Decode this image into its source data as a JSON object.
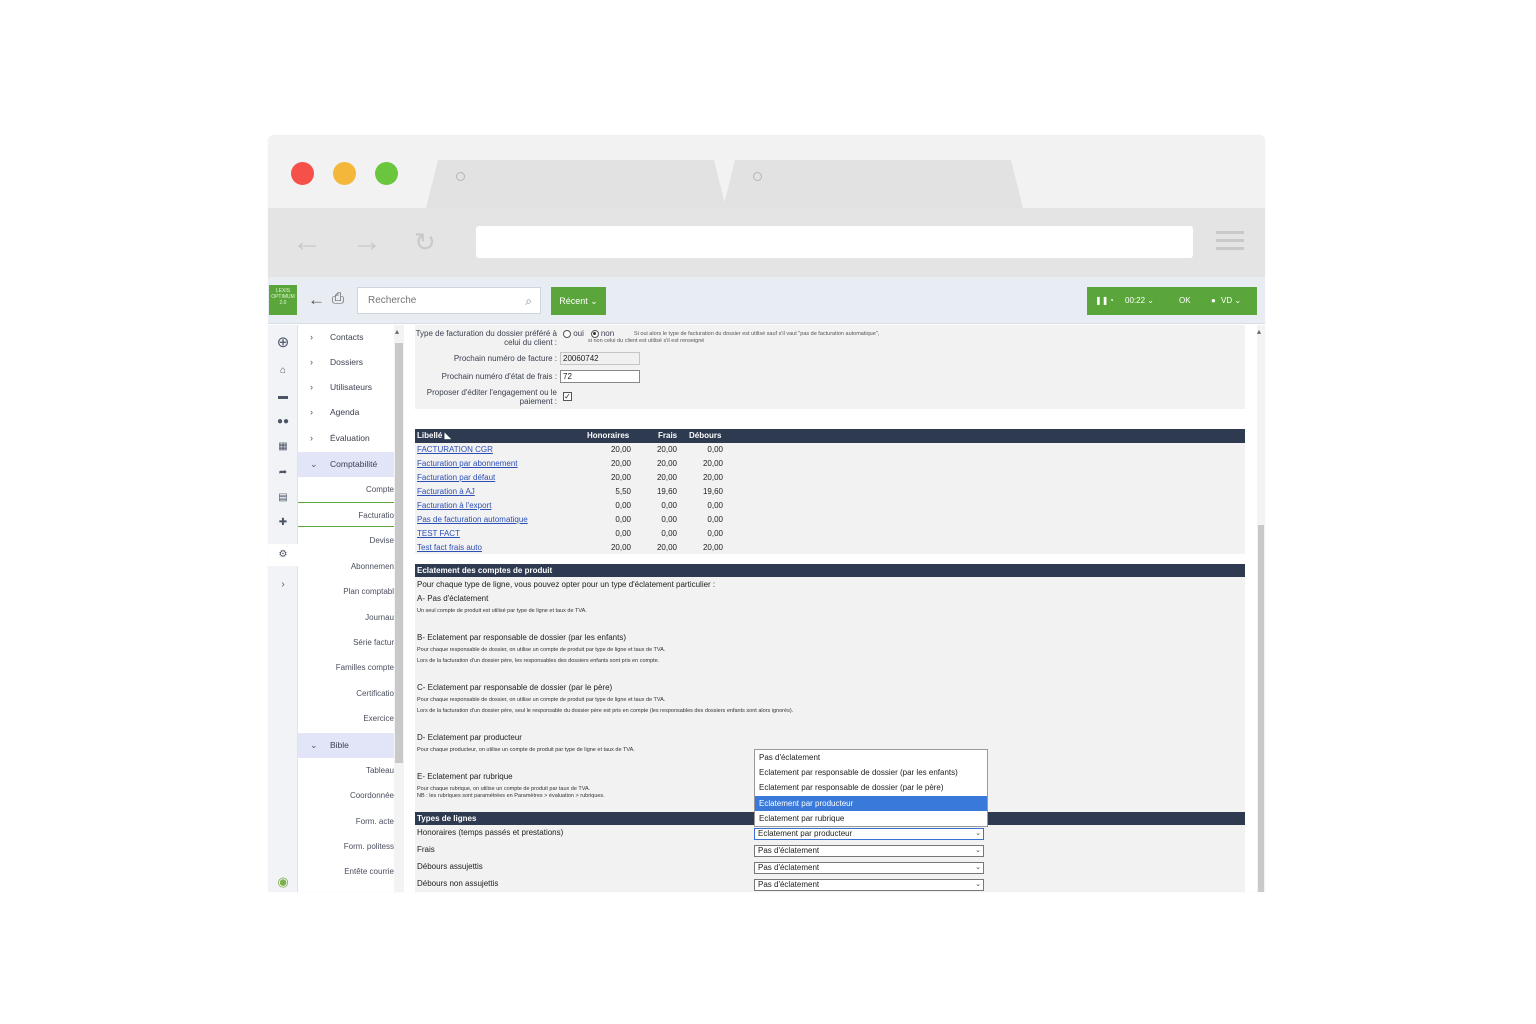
{
  "toolbar": {
    "logo_text": "LEXIS OPTIMUM 2.0",
    "search_placeholder": "Recherche",
    "recent_label": "Récent ⌄",
    "timer": "00:22 ⌄",
    "ok": "OK",
    "user": "VD ⌄"
  },
  "tree": {
    "items": [
      "Contacts",
      "Dossiers",
      "Utilisateurs",
      "Agenda",
      "Évaluation",
      "Comptabilité"
    ],
    "compta_sub": [
      "Compte",
      "Facturatio",
      "Devise",
      "Abonnemen",
      "Plan comptabl",
      "Journau",
      "Série factur",
      "Familles compte",
      "Certificatio",
      "Exercice"
    ],
    "bible": "Bible",
    "bible_sub": [
      "Tableau",
      "Coordonnée",
      "Form. acte",
      "Form. politess",
      "Entête courrie"
    ]
  },
  "form": {
    "type_label": "Type de facturation du dossier préféré à celui du client :",
    "oui": "oui",
    "non": "non",
    "type_hint1": "Si oui alors le type de facturation du dossier est utilisé sauf s'il vaut \"pas de facturation automatique\",",
    "type_hint2": "si non celui du client est utilisé s'il est renseigné",
    "next_invoice_label": "Prochain numéro de facture :",
    "next_invoice_value": "20060742",
    "next_fees_label": "Prochain numéro d'état de frais :",
    "next_fees_value": "72",
    "propose_label": "Proposer d'éditer l'engagement ou le paiement :"
  },
  "table": {
    "headers": [
      "Libellé ◣",
      "Honoraires",
      "Frais",
      "Débours"
    ],
    "rows": [
      [
        "FACTURATION CGR",
        "20,00",
        "20,00",
        "0,00"
      ],
      [
        "Facturation par abonnement",
        "20,00",
        "20,00",
        "20,00"
      ],
      [
        "Facturation par défaut",
        "20,00",
        "20,00",
        "20,00"
      ],
      [
        "Facturation à AJ",
        "5,50",
        "19,60",
        "19,60"
      ],
      [
        "Facturation à l'export",
        "0,00",
        "0,00",
        "0,00"
      ],
      [
        "Pas de facturation automatique",
        "0,00",
        "0,00",
        "0,00"
      ],
      [
        "TEST FACT",
        "0,00",
        "0,00",
        "0,00"
      ],
      [
        "Test fact frais auto",
        "20,00",
        "20,00",
        "20,00"
      ]
    ]
  },
  "eclatement": {
    "title": "Eclatement des comptes de produit",
    "intro": "Pour chaque type de ligne, vous pouvez opter pour un type d'éclatement particulier :",
    "a_title": "A- Pas d'éclatement",
    "a_desc": "Un seul compte de produit est utilisé par type de ligne et taux de TVA.",
    "b_title": "B- Eclatement par responsable de dossier (par les enfants)",
    "b_desc1": "Pour chaque responsable de dossier, on utilise un compte de produit par type de ligne et taux de TVA.",
    "b_desc2": "Lors de la facturation d'un dossier père, les responsables des dossiers enfants sont pris en compte.",
    "c_title": "C- Eclatement par responsable de dossier (par le père)",
    "c_desc1": "Pour chaque responsable de dossier, on utilise un compte de produit par type de ligne et taux de TVA.",
    "c_desc2": "Lors de la facturation d'un dossier père, seul le responsable du dossier père est pris en compte (les responsables des dossiers enfants sont alors ignorés).",
    "d_title": "D- Eclatement par producteur",
    "d_desc": "Pour chaque producteur, on utilise un compte de produit par type de ligne et taux de TVA.",
    "e_title": "E- Eclatement par rubrique",
    "e_desc1": "Pour chaque rubrique, on utilise un compte de produit par taux de TVA.",
    "e_desc2": "NB : les rubriques sont paramétrées en Paramètres > évaluation > rubriques."
  },
  "dropdown_options": [
    "Pas d'éclatement",
    "Eclatement par responsable de dossier (par les enfants)",
    "Eclatement par responsable de dossier (par le père)",
    "Eclatement par producteur",
    "Eclatement par rubrique"
  ],
  "types": {
    "title": "Types de lignes",
    "rows": [
      {
        "label": "Honoraires (temps passés et prestations)",
        "value": "Eclatement par producteur"
      },
      {
        "label": "Frais",
        "value": "Pas d'éclatement"
      },
      {
        "label": "Débours assujettis",
        "value": "Pas d'éclatement"
      },
      {
        "label": "Débours non assujettis",
        "value": "Pas d'éclatement"
      }
    ]
  }
}
